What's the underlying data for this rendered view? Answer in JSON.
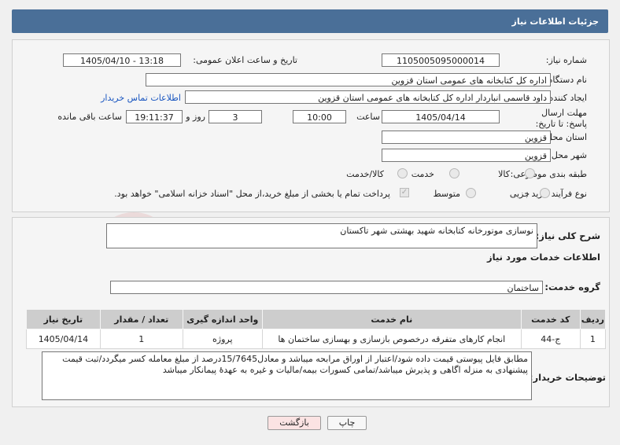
{
  "title": "جزئیات اطلاعات نیاز",
  "fields": {
    "need_number_label": "شماره نیاز:",
    "need_number": "1105005095000014",
    "announce_label": "تاریخ و ساعت اعلان عمومی:",
    "announce_value": "1405/04/10 - 13:18",
    "buyer_org_label": "نام دستگاه خریدار:",
    "buyer_org": "اداره کل کتابخانه های عمومی استان قزوین",
    "creator_label": "ایجاد کننده درخواست:",
    "creator": "داود قاسمی انباردار اداره کل کتابخانه های عمومی استان قزوین",
    "contact_link": "اطلاعات تماس خریدار",
    "deadline_label": "مهلت ارسال پاسخ: تا تاریخ:",
    "deadline_date": "1405/04/14",
    "time_label": "ساعت",
    "deadline_time": "10:00",
    "days_value": "3",
    "days_label": "روز و",
    "remaining_time": "19:11:37",
    "remaining_label": "ساعت باقی مانده",
    "province_label": "استان محل تحویل:",
    "province": "قزوین",
    "city_label": "شهر محل تحویل:",
    "city": "قزوین",
    "category_label": "طبقه بندی موضوعی:",
    "category_options": [
      "کالا",
      "خدمت",
      "کالا/خدمت"
    ],
    "process_label": "نوع فرآیند خرید :",
    "process_options": [
      "جزیی",
      "متوسط"
    ],
    "payment_note": "پرداخت تمام یا بخشی از مبلغ خرید،از محل \"اسناد خزانه اسلامی\" خواهد بود."
  },
  "details": {
    "summary_label": "شرح کلی نیاز:",
    "summary": "نوسازی موتورخانه کتابخانه شهید بهشتی شهر تاکستان",
    "services_heading": "اطلاعات خدمات مورد نیاز",
    "group_label": "گروه خدمت:",
    "group": "ساختمان",
    "table": {
      "headers": [
        "ردیف",
        "کد خدمت",
        "نام خدمت",
        "واحد اندازه گیری",
        "تعداد / مقدار",
        "تاریخ نیاز"
      ],
      "rows": [
        [
          "1",
          "ج-44",
          "انجام کارهای متفرقه درخصوص بازسازی و بهسازی ساختمان ها",
          "پروژه",
          "1",
          "1405/04/14"
        ]
      ]
    },
    "buyer_notes_label": "توضیحات خریدار:",
    "buyer_notes": "مطابق فایل پیوستی قیمت داده شود/اعتبار از اوراق مرابحه میباشد و معادل15/7645درصد از مبلغ معامله کسر میگردد/ثبت قیمت پیشنهادی به منزله اگاهی و پذیرش میباشد/تمامی کسورات بیمه/مالیات و غیره به عهدۀ پیمانکار میباشد"
  },
  "buttons": {
    "print": "چاپ",
    "back": "بازگشت"
  },
  "watermark": "AriaTender.net",
  "colors": {
    "header_bg": "#4a6f98",
    "link": "#1a56c0",
    "back_button": "#fbe3e3"
  }
}
